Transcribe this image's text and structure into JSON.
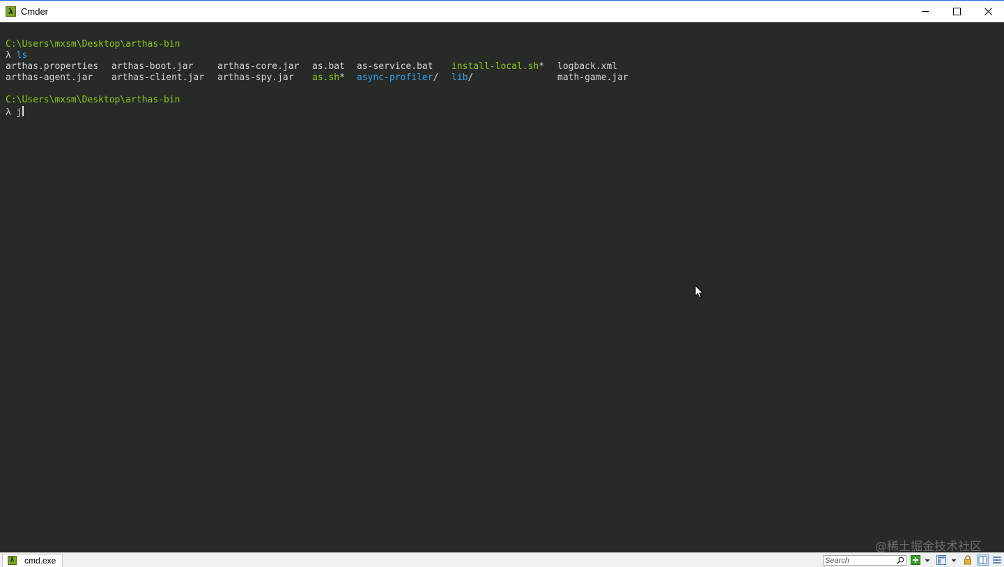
{
  "window": {
    "title": "Cmder",
    "icon_glyph": "λ",
    "icon": "cmder-lambda-icon"
  },
  "terminal": {
    "prompt_path_1": "C:\\Users\\mxsm\\Desktop\\arthas-bin",
    "prompt_symbol_1": "λ",
    "command_1": "ls",
    "listing": {
      "row1": [
        {
          "name": "arthas.properties",
          "color": "#d4d4d4"
        },
        {
          "name": "arthas-boot.jar",
          "color": "#d4d4d4"
        },
        {
          "name": "arthas-core.jar",
          "color": "#d4d4d4"
        },
        {
          "name": "as.bat",
          "color": "#d4d4d4"
        },
        {
          "name": "as-service.bat",
          "color": "#d4d4d4"
        },
        {
          "name": "install-local.sh",
          "suffix": "*",
          "color": "#8fc31f"
        },
        {
          "name": "logback.xml",
          "color": "#d4d4d4"
        }
      ],
      "row2": [
        {
          "name": "arthas-agent.jar",
          "color": "#d4d4d4"
        },
        {
          "name": "arthas-client.jar",
          "color": "#d4d4d4"
        },
        {
          "name": "arthas-spy.jar",
          "color": "#d4d4d4"
        },
        {
          "name": "as.sh",
          "suffix": "*",
          "color": "#8fc31f"
        },
        {
          "name": "async-profiler",
          "suffix": "/",
          "color": "#3aa0e8"
        },
        {
          "name": "lib",
          "suffix": "/",
          "color": "#3aa0e8"
        },
        {
          "name": "math-game.jar",
          "color": "#d4d4d4"
        }
      ]
    },
    "prompt_path_2": "C:\\Users\\mxsm\\Desktop\\arthas-bin",
    "prompt_symbol_2": "λ",
    "current_input": "j"
  },
  "watermark": "@稀土掘金技术社区",
  "statusbar": {
    "tab_label": "cmd.exe",
    "tab_icon_glyph": "λ",
    "search_placeholder": "Search",
    "icons": [
      "new-console-icon",
      "dropdown-arrow-icon",
      "layout-icon",
      "dropdown-arrow-icon",
      "lock-icon",
      "split-view-icon",
      "menu-lines-icon"
    ]
  },
  "colors": {
    "terminal_bg": "#272b27",
    "prompt_green": "#8fc31f",
    "dir_blue": "#3aa0e8",
    "text": "#d4d4d4"
  }
}
